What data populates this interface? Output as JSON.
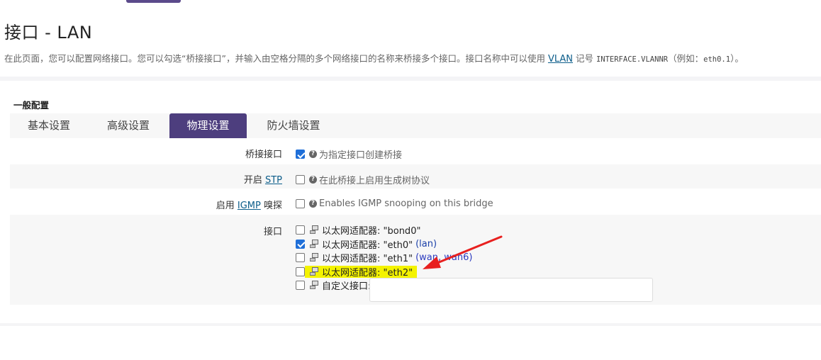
{
  "page": {
    "title": "接口 - LAN",
    "desc_before": "在此页面，您可以配置网络接口。您可以勾选“桥接接口”，并输入由空格分隔的多个网络接口的名称来桥接多个接口。接口名称中可以使用 ",
    "desc_link": "VLAN",
    "desc_mid": " 记号 ",
    "desc_code": "INTERFACE.VLANNR",
    "desc_after": "（例如：",
    "desc_code2": "eth0.1",
    "desc_end": "）。"
  },
  "section": {
    "title": "一般配置"
  },
  "tabs": [
    {
      "label": "基本设置"
    },
    {
      "label": "高级设置"
    },
    {
      "label": "物理设置"
    },
    {
      "label": "防火墙设置"
    }
  ],
  "form": {
    "bridge": {
      "label": "桥接接口",
      "checked": true,
      "help": "为指定接口创建桥接"
    },
    "stp": {
      "label_prefix": "开启 ",
      "label_link": "STP",
      "checked": false,
      "help": "在此桥接上启用生成树协议"
    },
    "igmp": {
      "label_prefix": "启用 ",
      "label_link": "IGMP",
      "label_suffix": " 嗅探",
      "checked": false,
      "help": "Enables IGMP snooping on this bridge"
    },
    "interfaces": {
      "label": "接口",
      "items": [
        {
          "name": "以太网适配器: \"bond0\"",
          "zone": "",
          "checked": false
        },
        {
          "name": "以太网适配器: \"eth0\"",
          "zone": "(lan)",
          "checked": true
        },
        {
          "name": "以太网适配器: \"eth1\"",
          "zone": "(wan, wan6)",
          "checked": false
        },
        {
          "name": "以太网适配器: \"eth2\"",
          "zone": "",
          "checked": false,
          "highlighted": true
        },
        {
          "name": "自定义接口:",
          "zone": "",
          "checked": false
        }
      ]
    }
  },
  "colors": {
    "accent": "#4d3e7e",
    "link": "#0c5d8a",
    "highlight": "#f4f300",
    "arrow": "#e8201f"
  }
}
